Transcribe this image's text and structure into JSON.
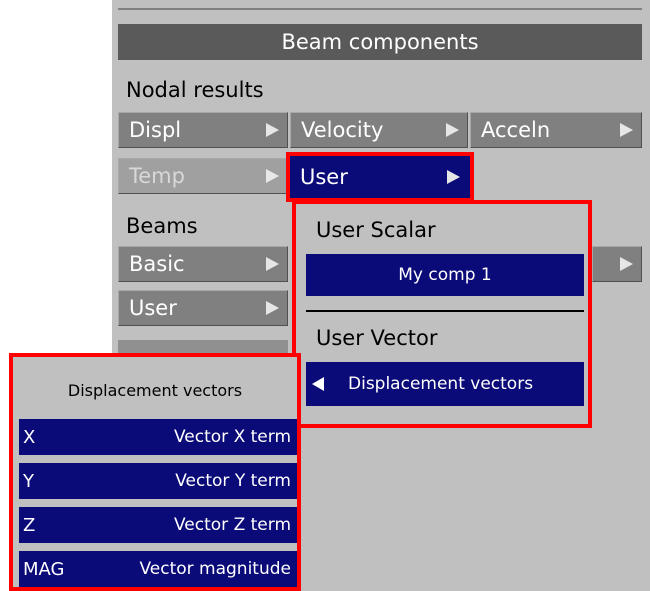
{
  "panel": {
    "header": "Beam components",
    "nodal_results_label": "Nodal results",
    "beams_label": "Beams",
    "nodal_buttons": [
      {
        "label": "Displ",
        "state": "normal"
      },
      {
        "label": "Velocity",
        "state": "normal"
      },
      {
        "label": "Acceln",
        "state": "normal"
      },
      {
        "label": "Temp",
        "state": "disabled"
      },
      {
        "label": "User",
        "state": "selected"
      }
    ],
    "beam_buttons": [
      {
        "label": "Basic"
      },
      {
        "label": "User"
      }
    ]
  },
  "user_popup": {
    "scalar_heading": "User Scalar",
    "scalar_item": "My comp 1",
    "vector_heading": "User Vector",
    "vector_item": "Displacement vectors"
  },
  "vector_popup": {
    "title": "Displacement vectors",
    "items": [
      {
        "key": "X",
        "label": "Vector X term"
      },
      {
        "key": "Y",
        "label": "Vector Y term"
      },
      {
        "key": "Z",
        "label": "Vector Z term"
      },
      {
        "key": "MAG",
        "label": "Vector magnitude"
      }
    ]
  },
  "colors": {
    "panel_bg": "#c0c0c0",
    "header_bg": "#5a5a5a",
    "button_grey": "#808080",
    "selected_blue": "#0a0a78",
    "highlight_red": "#ff0000"
  }
}
